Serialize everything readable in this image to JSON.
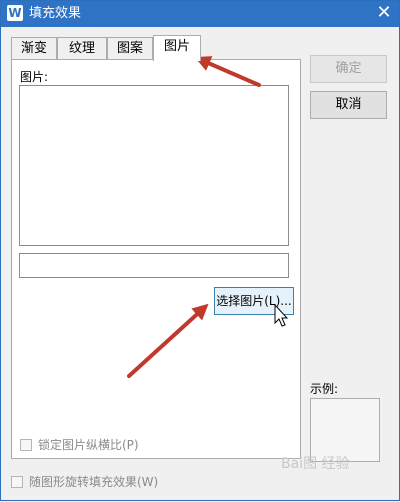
{
  "window": {
    "title": "填充效果",
    "app_icon_letter": "W",
    "close_glyph": "✕"
  },
  "tabs": [
    {
      "label": "渐变",
      "active": false
    },
    {
      "label": "纹理",
      "active": false
    },
    {
      "label": "图案",
      "active": false
    },
    {
      "label": "图片",
      "active": true
    }
  ],
  "picture_panel": {
    "label": "图片:",
    "path_value": "",
    "select_button": "选择图片(L)...",
    "lock_ratio_checkbox": {
      "label": "锁定图片纵横比(P)",
      "checked": false,
      "enabled": false
    }
  },
  "rotate_checkbox": {
    "label": "随图形旋转填充效果(W)",
    "checked": false,
    "enabled": false
  },
  "buttons": {
    "ok": {
      "label": "确定",
      "enabled": false
    },
    "cancel": {
      "label": "取消",
      "enabled": true
    }
  },
  "example": {
    "label": "示例:"
  },
  "watermark": "Bai图 经验",
  "colors": {
    "titlebar": "#2f73c6",
    "arrow": "#c0392b",
    "select_button_bg": "#e5f1fb"
  }
}
